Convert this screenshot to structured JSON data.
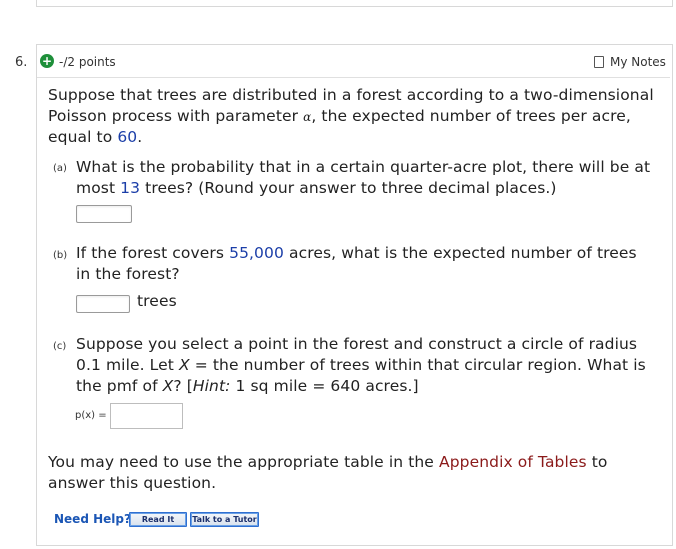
{
  "question": {
    "number": "6.",
    "points": "-/2 points",
    "my_notes": "My Notes",
    "intro": {
      "l1": "Suppose that trees are distributed in a forest according to a two-dimensional",
      "l2a": "Poisson process with parameter ",
      "alpha": "α",
      "l2b": ", the expected number of trees per acre,",
      "l3a": "equal to ",
      "value": "60",
      "l3b": "."
    },
    "part_a": {
      "label": "(a)",
      "l1": "What is the probability that in a certain quarter-acre plot, there will be at",
      "l2a": "most ",
      "value": "13",
      "l2b": " trees? (Round your answer to three decimal places.)"
    },
    "part_b": {
      "label": "(b)",
      "l1a": "If the forest covers ",
      "value": "55,000",
      "l1b": " acres, what is the expected number of trees",
      "l2": "in the forest?",
      "unit": "trees"
    },
    "part_c": {
      "label": "(c)",
      "l1": "Suppose you select a point in the forest and construct a circle of radius",
      "l2a": "0.1 mile. Let ",
      "var_x": "X",
      "l2b": " = the number of trees within that circular region. What is",
      "l3a": "the pmf of ",
      "l3b": "? [",
      "hint": "Hint:",
      "l3c": " 1 sq mile = 640 acres.]",
      "pmf_label": "p(x) ="
    },
    "footer": {
      "l1a": "You may need to use the appropriate table in the ",
      "link": "Appendix of Tables",
      "l1b": " to",
      "l2": "answer this question."
    },
    "help": {
      "need_help": "Need Help?",
      "read_it": "Read It",
      "talk_tutor": "Talk to a Tutor"
    }
  }
}
